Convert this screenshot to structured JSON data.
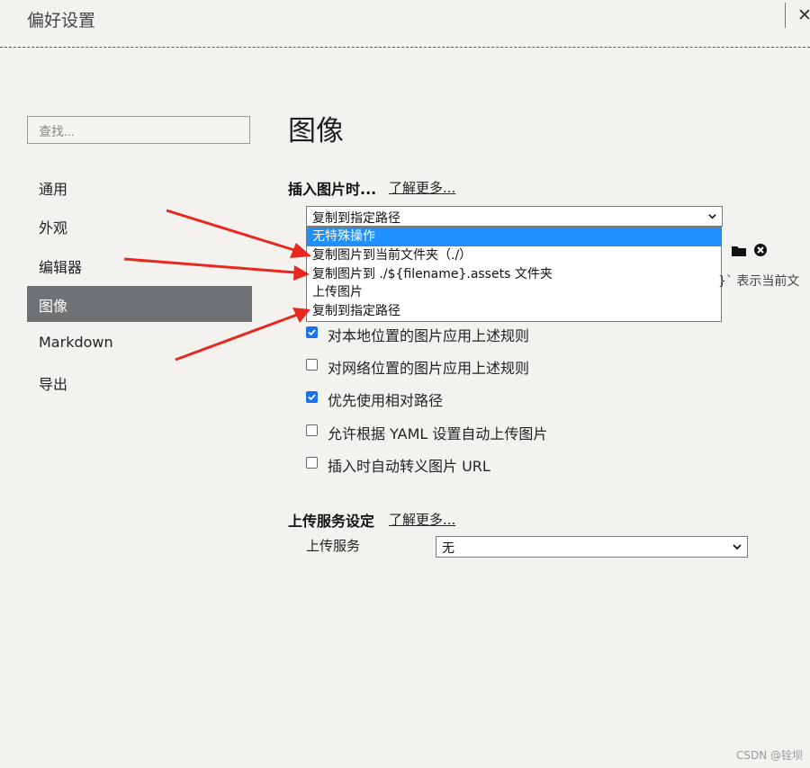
{
  "window": {
    "title": "偏好设置",
    "close_glyph": "✕"
  },
  "sidebar": {
    "search_placeholder": "查找...",
    "items": [
      {
        "label": "通用"
      },
      {
        "label": "外观"
      },
      {
        "label": "编辑器"
      },
      {
        "label": "图像",
        "active": true
      },
      {
        "label": "Markdown"
      },
      {
        "label": "导出"
      }
    ]
  },
  "main": {
    "title": "图像",
    "insert_section": {
      "heading": "插入图片时...",
      "learn_more": "了解更多...",
      "selected_value": "复制到指定路径",
      "options": [
        {
          "label": "无特殊操作",
          "highlighted": true
        },
        {
          "label": "复制图片到当前文件夹（./）"
        },
        {
          "label": "复制图片到 ./${filename}.assets 文件夹"
        },
        {
          "label": "上传图片"
        },
        {
          "label": "复制到指定路径"
        }
      ],
      "hint_fragment": "}` 表示当前文"
    },
    "checkboxes": [
      {
        "label": "对本地位置的图片应用上述规则",
        "checked": true
      },
      {
        "label": "对网络位置的图片应用上述规则",
        "checked": false
      },
      {
        "label": "优先使用相对路径",
        "checked": true
      },
      {
        "label": "允许根据 YAML 设置自动上传图片",
        "checked": false
      },
      {
        "label": "插入时自动转义图片 URL",
        "checked": false
      }
    ],
    "upload_section": {
      "heading": "上传服务设定",
      "learn_more": "了解更多...",
      "service_label": "上传服务",
      "service_value": "无"
    }
  },
  "watermark": "CSDN @铨坝",
  "colors": {
    "accent": "#1e90ff",
    "checkbox": "#1a73e8",
    "nav_active_bg": "#6e7275",
    "arrow": "#e8281e"
  }
}
